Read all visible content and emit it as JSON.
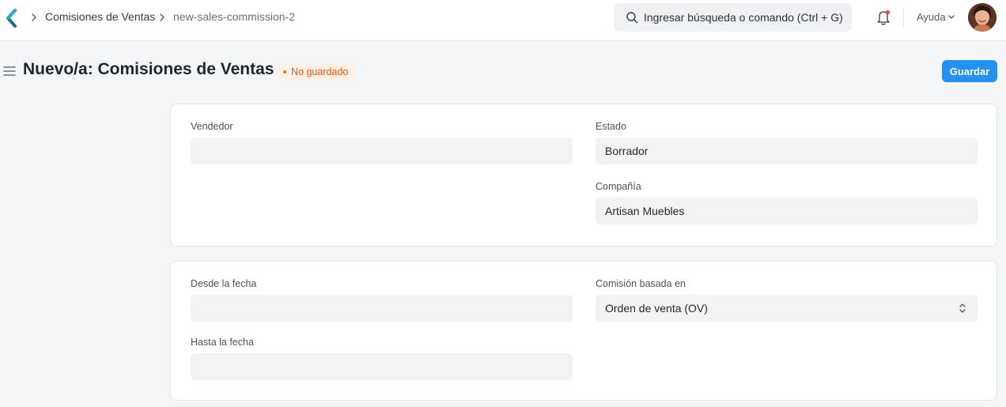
{
  "navbar": {
    "breadcrumbs": [
      {
        "label": "Comisiones de Ventas"
      },
      {
        "label": "new-sales-commission-2"
      }
    ],
    "search": {
      "placeholder": "Ingresar búsqueda o comando (Ctrl + G)"
    },
    "help_label": "Ayuda"
  },
  "page": {
    "title": "Nuevo/a: Comisiones de Ventas",
    "status_badge": "No guardado",
    "save_label": "Guardar"
  },
  "sections": [
    {
      "fields": [
        {
          "label": "Vendedor",
          "value": ""
        },
        {
          "label": "Estado",
          "value": "Borrador"
        },
        {
          "label": "Compañía",
          "value": "Artisan Muebles"
        }
      ]
    },
    {
      "fields": [
        {
          "label": "Desde la fecha",
          "value": ""
        },
        {
          "label": "Hasta la fecha",
          "value": ""
        },
        {
          "label": "Comisión basada en",
          "value": "Orden de venta (OV)"
        }
      ]
    }
  ],
  "colors": {
    "primary": "#2490ef",
    "badge_text": "#e2590e",
    "badge_bg": "#fff0e6",
    "indicator_red": "#e24c4c"
  },
  "icons": [
    "app-logo-icon",
    "chevron-right-icon",
    "search-icon",
    "bell-icon",
    "chevron-down-icon",
    "hamburger-menu-icon",
    "select-arrows-icon"
  ]
}
